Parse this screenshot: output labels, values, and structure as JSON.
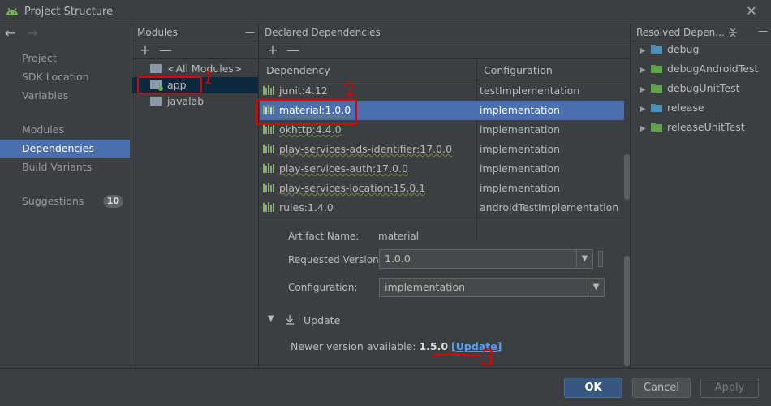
{
  "window": {
    "title": "Project Structure",
    "close_glyph": "✕"
  },
  "nav": {
    "back_glyph": "←",
    "forward_glyph": "→",
    "items": [
      {
        "label": "Project"
      },
      {
        "label": "SDK Location"
      },
      {
        "label": "Variables"
      },
      {
        "label": "Modules"
      },
      {
        "label": "Dependencies",
        "selected": true
      },
      {
        "label": "Build Variants"
      },
      {
        "label": "Suggestions",
        "badge": "10"
      }
    ]
  },
  "modules": {
    "header": "Modules",
    "collapse_glyph": "—",
    "add_glyph": "+",
    "remove_glyph": "—",
    "items": [
      {
        "label": "<All Modules>"
      },
      {
        "label": "app",
        "selected": true
      },
      {
        "label": "javalab"
      }
    ]
  },
  "declared": {
    "header": "Declared Dependencies",
    "add_glyph": "+",
    "remove_glyph": "—",
    "columns": [
      "Dependency",
      "Configuration"
    ],
    "rows": [
      {
        "dependency": "junit:4.12",
        "configuration": "testImplementation"
      },
      {
        "dependency": "material:1.0.0",
        "configuration": "implementation",
        "selected": true
      },
      {
        "dependency": "okhttp:4.4.0",
        "configuration": "implementation"
      },
      {
        "dependency": "play-services-ads-identifier:17.0.0",
        "configuration": "implementation"
      },
      {
        "dependency": "play-services-auth:17.0.0",
        "configuration": "implementation"
      },
      {
        "dependency": "play-services-location:15.0.1",
        "configuration": "implementation"
      },
      {
        "dependency": "rules:1.4.0",
        "configuration": "androidTestImplementation"
      }
    ],
    "details": {
      "artifact_label": "Artifact Name:",
      "artifact_value": "material",
      "version_label": "Requested Version:",
      "version_value": "1.0.0",
      "config_label": "Configuration:",
      "config_value": "implementation",
      "update_section": "Update",
      "newer_text": "Newer version available:",
      "newer_version": "1.5.0",
      "update_link": "[Update]"
    }
  },
  "resolved": {
    "header": "Resolved Depen...",
    "collapse_glyph": "—",
    "items": [
      {
        "label": "debug",
        "color": "#4a90b8"
      },
      {
        "label": "debugAndroidTest",
        "color": "#5fa34a"
      },
      {
        "label": "debugUnitTest",
        "color": "#5fa34a"
      },
      {
        "label": "release",
        "color": "#4a90b8"
      },
      {
        "label": "releaseUnitTest",
        "color": "#5fa34a"
      }
    ]
  },
  "buttons": {
    "ok": "OK",
    "cancel": "Cancel",
    "apply": "Apply"
  },
  "colors": {
    "selection": "#4b6eaf",
    "link": "#589df6",
    "annotation": "#e00000"
  },
  "annotations": [
    "1",
    "2",
    "3"
  ]
}
